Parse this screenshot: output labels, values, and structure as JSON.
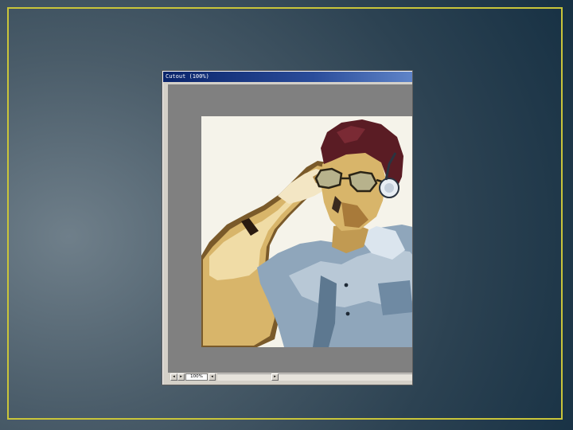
{
  "window": {
    "title": "Cutout (100%)"
  },
  "statusbar": {
    "zoom": "100%",
    "nav_prev_glyph": "◂",
    "nav_next_glyph": "▸",
    "scroll_left_glyph": "◂",
    "scroll_right_glyph": "▸"
  },
  "icons": {
    "nav_prev": "triangle-left-icon",
    "nav_next": "triangle-right-icon",
    "scroll_left": "arrow-left-icon",
    "scroll_right": "arrow-right-icon"
  },
  "colors": {
    "slide_border": "#c9c53a",
    "titlebar": "#0a246a",
    "canvas_bg": "#808080",
    "window_chrome": "#d4d0c8"
  }
}
